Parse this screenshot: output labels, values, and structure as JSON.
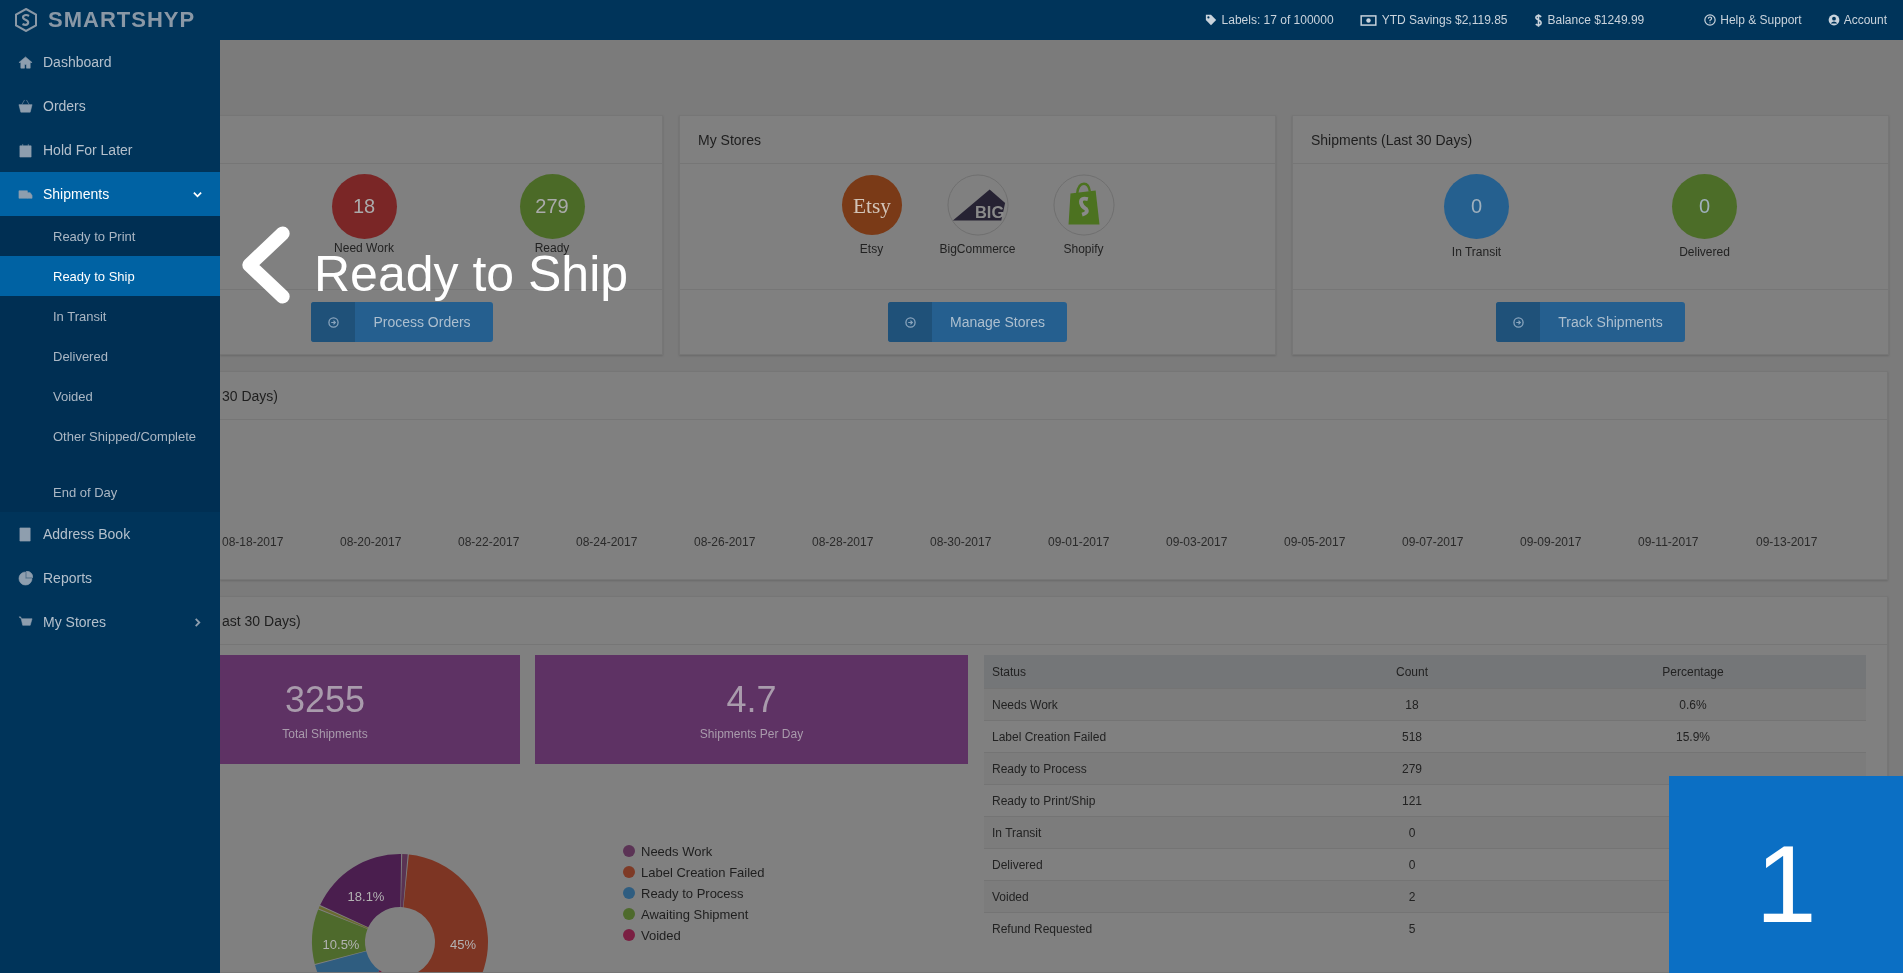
{
  "header": {
    "logo": "SMARTSHYP",
    "stats": [
      {
        "kind": "tag",
        "text": "Labels: 17 of 100000"
      },
      {
        "kind": "money",
        "text": "YTD Savings $2,119.85"
      },
      {
        "kind": "dollar",
        "text": "Balance $1249.99"
      }
    ],
    "links": [
      {
        "kind": "help",
        "text": "Help & Support"
      },
      {
        "kind": "account",
        "text": "Account"
      }
    ]
  },
  "sidebar": {
    "items": [
      {
        "label": "Dashboard",
        "selected": false
      },
      {
        "label": "Orders",
        "selected": false
      },
      {
        "label": "Hold For Later",
        "selected": false
      },
      {
        "label": "Shipments",
        "selected": true,
        "expanded": true,
        "children": [
          {
            "label": "Ready to Print",
            "kind": "link",
            "selected": false
          },
          {
            "label": "Ready to Ship",
            "kind": "link",
            "selected": true
          },
          {
            "label": "In Transit",
            "kind": "link",
            "selected": false
          },
          {
            "label": "Delivered",
            "kind": "link",
            "selected": false
          },
          {
            "label": "Voided",
            "kind": "link",
            "selected": false
          },
          {
            "label": "Other Shipped/Complete",
            "kind": "link",
            "selected": false
          },
          {
            "label": "End of Day",
            "kind": "spaced",
            "selected": false
          }
        ]
      },
      {
        "label": "Address Book",
        "selected": false
      },
      {
        "label": "Reports",
        "selected": false
      },
      {
        "label": "My Stores",
        "selected": false,
        "expanded": false
      }
    ]
  },
  "cards": [
    {
      "kind": "counts",
      "counts": [
        {
          "value": "18",
          "label": "Need Work",
          "color": "#7a2626"
        },
        {
          "value": "279",
          "label": "Ready",
          "color": "#4b6a27"
        }
      ],
      "button": "Process Orders"
    },
    {
      "kind": "stores",
      "title": "My Stores",
      "stores": [
        {
          "logo_text": "Etsy",
          "name": "Etsy"
        },
        {
          "logo_text": "BIG",
          "name": "BigCommerce"
        },
        {
          "name": "Shopify"
        }
      ],
      "button": "Manage Stores"
    },
    {
      "kind": "counts",
      "title": "Shipments (Last 30 Days)",
      "counts": [
        {
          "value": "0",
          "label": "In Transit",
          "color": "#25608f"
        },
        {
          "value": "0",
          "label": "Delivered",
          "color": "#4c6d28"
        }
      ],
      "button": "Track Shipments"
    }
  ],
  "trend": {
    "title": "30 Days)",
    "x_labels": [
      "08-18-2017",
      "08-20-2017",
      "08-22-2017",
      "08-24-2017",
      "08-26-2017",
      "08-28-2017",
      "08-30-2017",
      "09-01-2017",
      "09-03-2017",
      "09-05-2017",
      "09-07-2017",
      "09-09-2017",
      "09-11-2017",
      "09-13-2017"
    ]
  },
  "summary": {
    "title": "ast 30 Days)",
    "tiles": [
      {
        "value": "3255",
        "label": "Total Shipments"
      },
      {
        "value": "4.7",
        "label": "Shipments Per Day"
      }
    ],
    "slice_labels": [
      "18.1%",
      "45%",
      "10.5%"
    ],
    "legend": [
      {
        "label": "Needs Work",
        "color": "#5b3355"
      },
      {
        "label": "Label Creation Failed",
        "color": "#7e3a26"
      },
      {
        "label": "Ready to Process",
        "color": "#2f5d80"
      },
      {
        "label": "Awaiting Shipment",
        "color": "#4e6a2c"
      },
      {
        "label": "Voided",
        "color": "#7a1f42"
      }
    ],
    "table": {
      "columns": [
        "Status",
        "Count",
        "Percentage"
      ],
      "rows": [
        [
          "Needs Work",
          "18",
          "0.6%"
        ],
        [
          "Label Creation Failed",
          "518",
          "15.9%"
        ],
        [
          "Ready to Process",
          "279"
        ],
        [
          "Ready to Print/Ship",
          "121"
        ],
        [
          "In Transit",
          "0"
        ],
        [
          "Delivered",
          "0"
        ],
        [
          "Voided",
          "2"
        ],
        [
          "Refund Requested",
          "5"
        ]
      ]
    }
  },
  "callout": {
    "text": "Ready to Ship"
  },
  "step_badge": {
    "text": "1"
  }
}
